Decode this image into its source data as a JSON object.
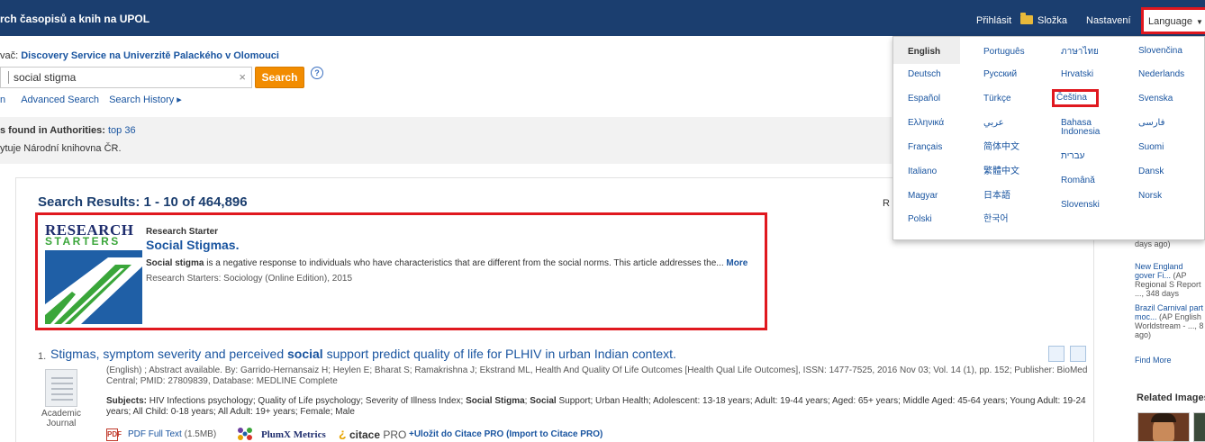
{
  "topbar": {
    "site_title": "rch časopisů a knih na UPOL",
    "login": "Přihlásit",
    "folder": "Složka",
    "settings": "Nastavení",
    "language_label": "Language",
    "language_caret": "▼"
  },
  "search": {
    "provider_prefix": "vač: ",
    "provider_name": "Discovery Service na Univerzitě Palackého v Olomouci",
    "query": "social stigma",
    "clear": "×",
    "button": "Search",
    "help": "?",
    "link_fragment": "n",
    "advanced": "Advanced Search",
    "history": "Search History ▸"
  },
  "authorities": {
    "label": "s found in Authorities:",
    "link": "top 36",
    "provider_note": "ytuje Národní knihovna ČR."
  },
  "results": {
    "heading": "Search Results: 1 - 10 of 464,896",
    "relevance_fragment": "R"
  },
  "research_starter": {
    "logo_line1": "RESEARCH",
    "logo_line2": "STARTERS",
    "label": "Research Starter",
    "title": "Social Stigmas.",
    "abstract_bold": "Social stigma",
    "abstract_rest": " is a negative response to individuals who have characteristics that are different from the social norms. This article addresses the... ",
    "more": "More",
    "source": "Research Starters: Sociology (Online Edition), 2015"
  },
  "result1": {
    "number": "1.",
    "title_a": "Stigmas, symptom severity and perceived ",
    "title_b": "social",
    "title_c": " support predict quality of life for PLHIV in urban Indian context.",
    "meta": "(English) ; Abstract available. By: Garrido-Hernansaiz H; Heylen E; Bharat S; Ramakrishna J; Ekstrand ML, Health And Quality Of Life Outcomes [Health Qual Life Outcomes], ISSN: 1477-7525, 2016 Nov 03; Vol. 14 (1), pp. 152; Publisher: BioMed Central; PMID: 27809839, Database: MEDLINE Complete",
    "subjects_label": "Subjects:",
    "subjects_a": " HIV Infections psychology; Quality of Life psychology; Severity of Illness Index; ",
    "subjects_b": "Social Stigma",
    "subjects_c": "; ",
    "subjects_d": "Social",
    "subjects_e": " Support; Urban Health; Adolescent: 13-18 years; Adult: 19-44 years; Aged: 65+ years; Middle Aged: 45-64 years; Young Adult: 19-24 years; All Child: 0-18 years; All Adult: 19+ years; Female; Male",
    "doc_type": "Academic Journal",
    "pdf_icon_text": "PDF",
    "pdf": "PDF Full Text",
    "pdf_size": " (1.5MB)",
    "plumx": "PlumX Metrics",
    "citace_mark": "¿",
    "citace_name": "citace",
    "citace_pro": " PRO",
    "citace_link": "+Uložit do Citace PRO (Import to Citace PRO)"
  },
  "language_menu": {
    "items": [
      "English",
      "Português",
      "ภาษาไทย",
      "Slovenčina",
      "Deutsch",
      "Русский",
      "Hrvatski",
      "Nederlands",
      "Español",
      "Türkçe",
      "Čeština",
      "Svenska",
      "Ελληνικά",
      "عربي",
      "Bahasa",
      "Indonesia",
      "فارسی",
      "Français",
      "简体中文",
      "עברית",
      "Suomi",
      "Italiano",
      "繁體中文",
      "Română",
      "Dansk",
      "Magyar",
      "日本語",
      "Slovenski",
      "Norsk",
      "Polski",
      "한국어"
    ]
  },
  "sidebar": {
    "news1": "days ago)",
    "news2_link": "New England gover Fi...",
    "news2_meta": " (AP Regional S Report ..., 348 days",
    "news3_link": "Brazil Carnival part moc...",
    "news3_meta": " (AP English Worldstream - ..., 8 ago)",
    "find_more": "Find More",
    "related_images": "Related Images"
  },
  "colors": {
    "header_bg": "#1b3e6f",
    "link": "#1a55a0",
    "search_button": "#f28c00",
    "highlight_border": "#e0181f"
  }
}
